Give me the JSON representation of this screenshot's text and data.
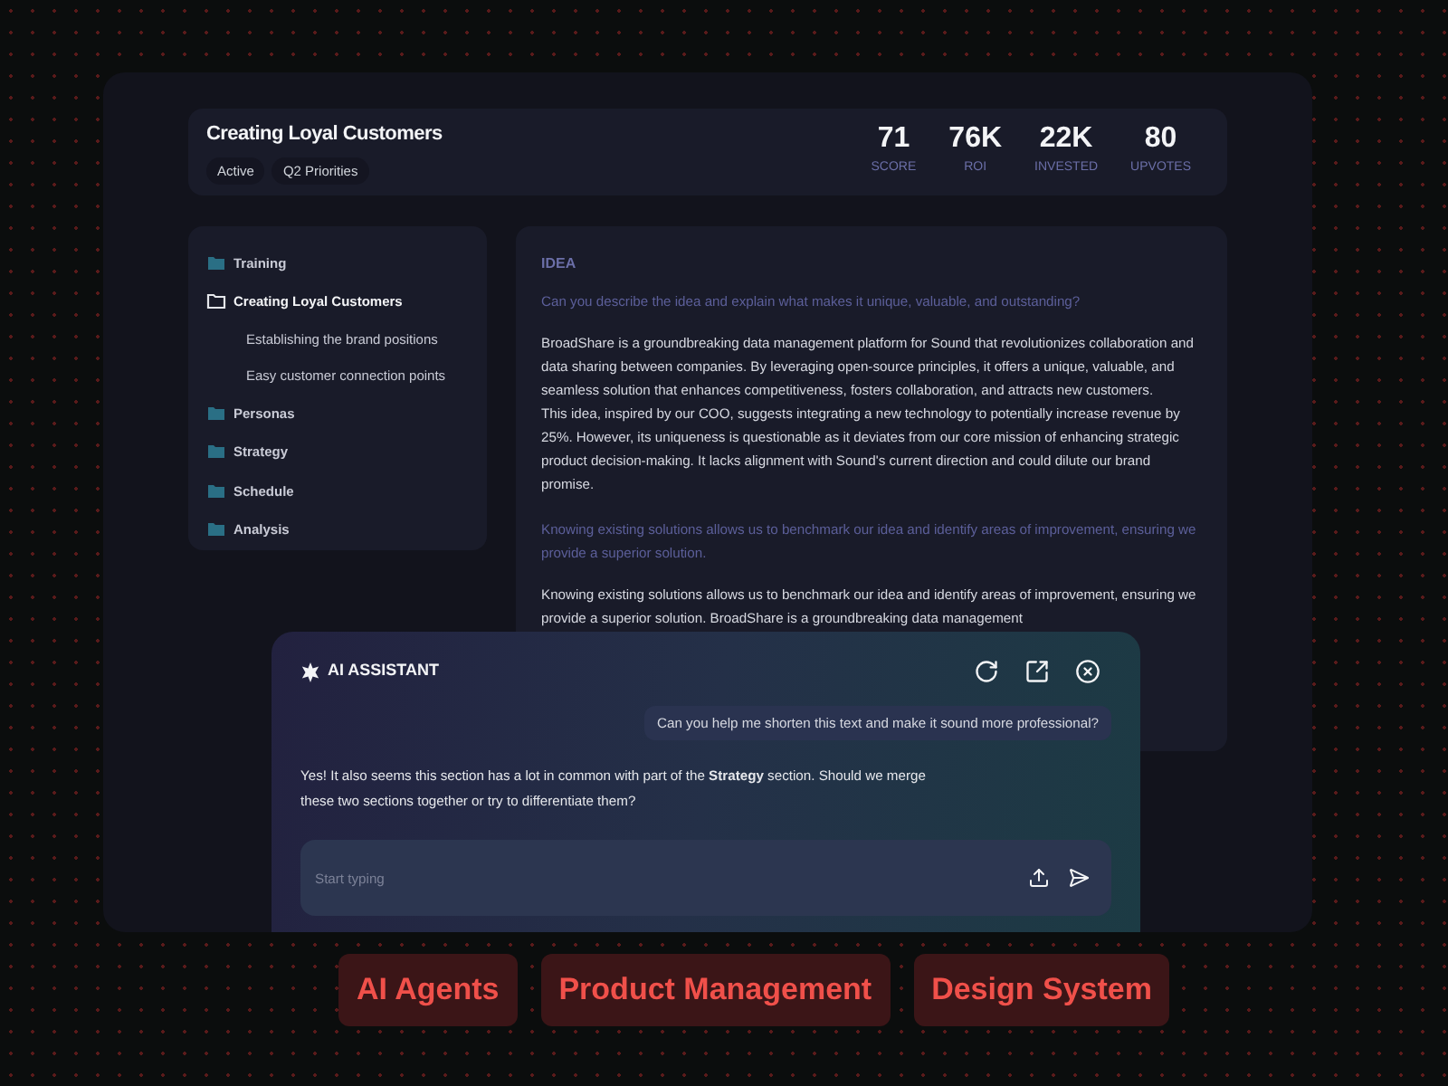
{
  "header": {
    "title": "Creating Loyal Customers",
    "tags": [
      "Active",
      "Q2 Priorities"
    ],
    "stats": [
      {
        "value": "71",
        "label": "SCORE"
      },
      {
        "value": "76K",
        "label": "ROI"
      },
      {
        "value": "22K",
        "label": "INVESTED"
      },
      {
        "value": "80",
        "label": "UPVOTES"
      }
    ]
  },
  "sidebar": {
    "items": [
      {
        "label": "Training",
        "expanded": false
      },
      {
        "label": "Creating Loyal Customers",
        "expanded": true,
        "children": [
          {
            "label": "Establishing the brand positions"
          },
          {
            "label": "Easy customer connection points"
          }
        ]
      },
      {
        "label": "Personas",
        "expanded": false
      },
      {
        "label": "Strategy",
        "expanded": false
      },
      {
        "label": "Schedule",
        "expanded": false
      },
      {
        "label": "Analysis",
        "expanded": false
      }
    ]
  },
  "content": {
    "heading": "IDEA",
    "blocks": [
      {
        "kind": "question",
        "text": "Can you describe the idea and explain what makes it unique, valuable, and outstanding?"
      },
      {
        "kind": "answer",
        "text": "BroadShare is a groundbreaking data management platform for Sound that revolutionizes collaboration and data sharing between companies. By leveraging open-source principles, it offers a unique, valuable, and seamless solution that enhances competitiveness, fosters collaboration, and attracts new customers.\nThis idea, inspired by our COO, suggests integrating a new technology to potentially increase revenue by 25%. However, its uniqueness is questionable as it deviates from our core mission of enhancing strategic product decision-making. It lacks alignment with Sound's current direction and could dilute our brand promise."
      },
      {
        "kind": "question",
        "text": "Knowing existing solutions allows us to benchmark our idea and identify areas of improvement, ensuring we provide a superior solution."
      },
      {
        "kind": "answer",
        "text": "Knowing existing solutions allows us to benchmark our idea and identify areas of improvement, ensuring we provide a superior solution. BroadShare is a groundbreaking data management"
      }
    ]
  },
  "assistant": {
    "title": "AI ASSISTANT",
    "messages": [
      {
        "kind": "user",
        "text": "Can you help me shorten this text and make it sound more professional?"
      },
      {
        "kind": "bot",
        "text": "Yes! It also seems this section has a lot in common with part of the **Strategy** section. Should we merge these two sections together or try to differentiate them?"
      }
    ],
    "input": {
      "placeholder": "Start typing"
    }
  },
  "topics": [
    "AI Agents",
    "Product Management",
    "Design System"
  ]
}
